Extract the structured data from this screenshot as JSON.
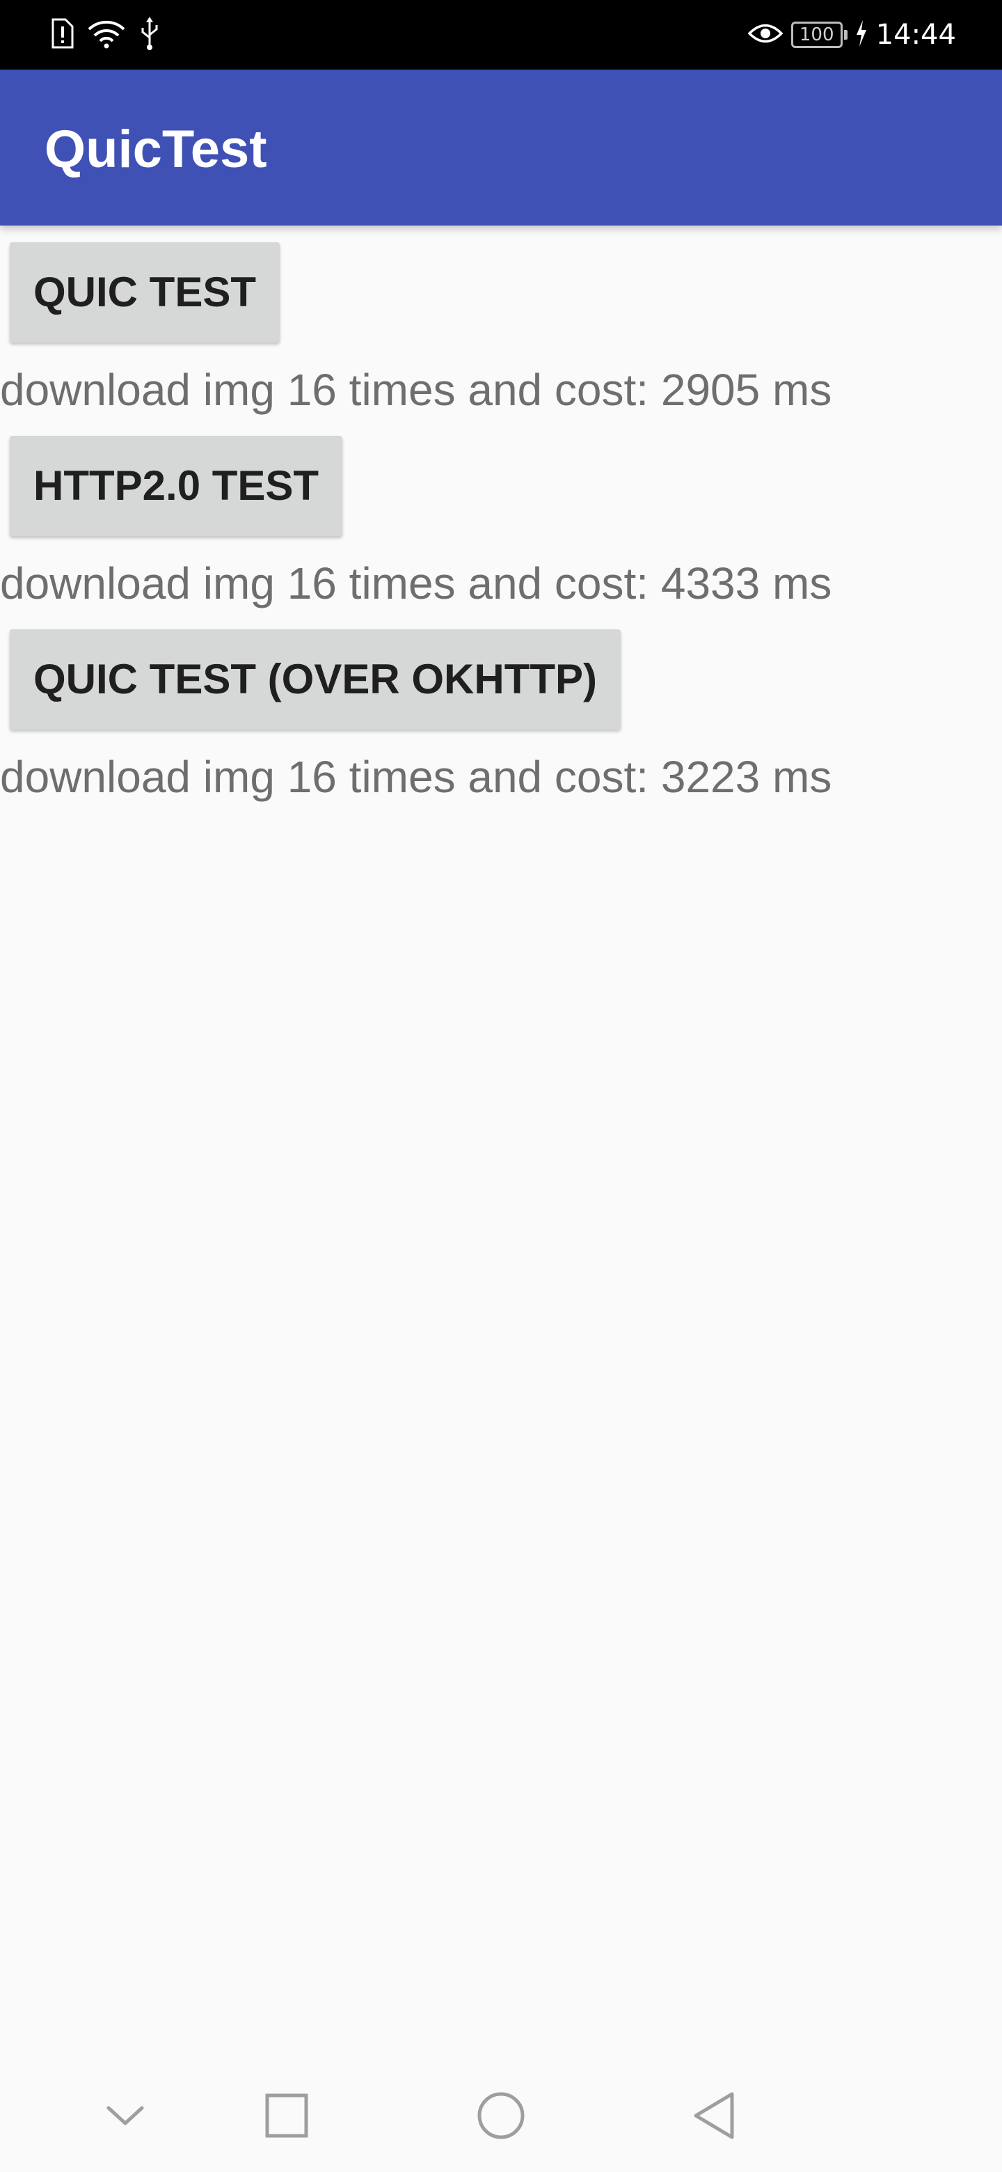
{
  "status_bar": {
    "time": "14:44",
    "battery": "100",
    "icons": [
      "sim-alert-icon",
      "wifi-icon",
      "usb-icon",
      "eye-icon",
      "battery-icon",
      "charging-icon"
    ]
  },
  "app_bar": {
    "title": "QuicTest",
    "color": "#3f51b5"
  },
  "tests": [
    {
      "button_label": "QUIC TEST",
      "result": "download img 16 times and cost: 2905 ms"
    },
    {
      "button_label": "HTTP2.0 TEST",
      "result": "download img 16 times and cost: 4333 ms"
    },
    {
      "button_label": "QUIC TEST (OVER OKHTTP)",
      "result": "download img 16 times and cost: 3223 ms"
    }
  ],
  "nav_bar": {
    "icons": [
      "hide-nav-chevron-icon",
      "recents-square-icon",
      "home-circle-icon",
      "back-triangle-icon"
    ]
  }
}
